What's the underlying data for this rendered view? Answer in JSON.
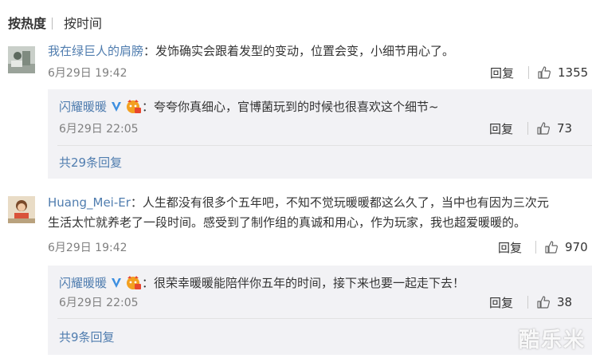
{
  "sort": {
    "hot_label": "按热度",
    "time_label": "按时间"
  },
  "colors": {
    "link": "#507daf",
    "reply_bg": "#f2f2f5",
    "text": "#333333",
    "meta": "#808080"
  },
  "comments": [
    {
      "user": "我在绿巨人的肩膀",
      "separator": "：",
      "text": "发饰确实会跟着发型的变动，位置会变，小细节用心了。",
      "time": "6月29日 19:42",
      "reply_label": "回复",
      "likes": "1355",
      "like_icon": "thumbs-up-icon",
      "reply": {
        "user": "闪耀暖暖",
        "badges": [
          "verified-v-icon",
          "member-badge-icon"
        ],
        "separator": "：",
        "text": "夸夸你真细心，官博菌玩到的时候也很喜欢这个细节~",
        "time": "6月29日 22:05",
        "reply_label": "回复",
        "likes": "73"
      },
      "more_replies": "共29条回复"
    },
    {
      "user": "Huang_Mei-Er",
      "separator": "：",
      "text_line1": "人生都没有很多个五年吧，不知不觉玩暖暖都这么久了，当中也有因为三次元",
      "text_line2": "生活太忙就养老了一段时间。感受到了制作组的真诚和用心，作为玩家，我也超爱暖暖的。",
      "time": "6月29日 19:42",
      "reply_label": "回复",
      "likes": "970",
      "reply": {
        "user": "闪耀暖暖",
        "badges": [
          "verified-v-icon",
          "member-badge-icon"
        ],
        "separator": "：",
        "text": "很荣幸暖暖能陪伴你五年的时间，接下来也要一起走下去！",
        "time": "6月29日 22:05",
        "reply_label": "回复",
        "likes": "38"
      },
      "more_replies": "共9条回复"
    }
  ],
  "watermark": "酷乐米"
}
